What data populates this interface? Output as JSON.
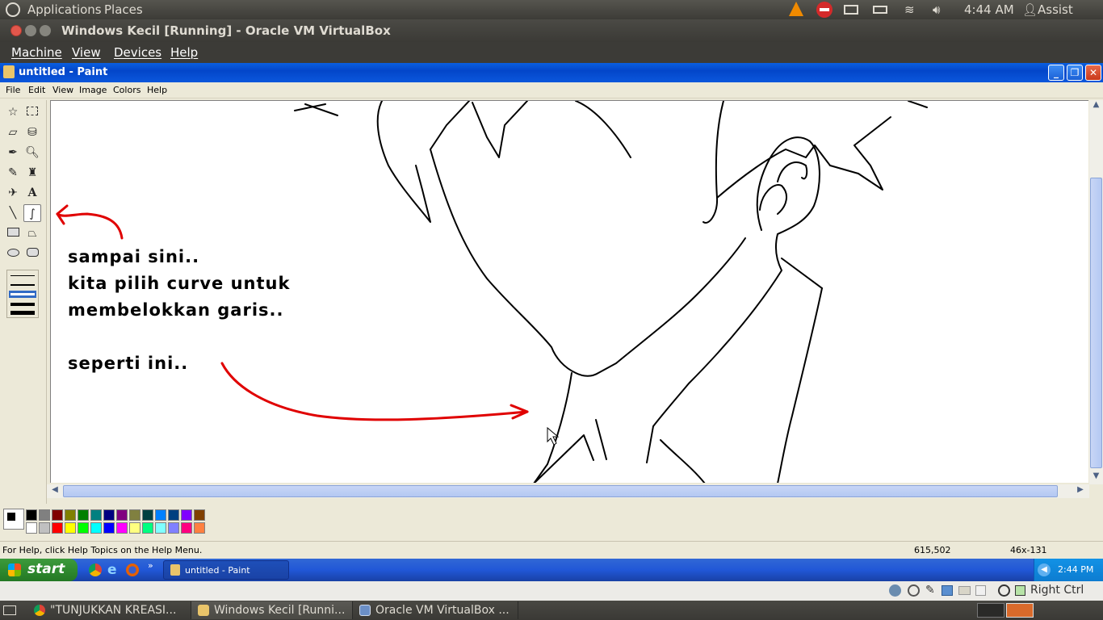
{
  "ubuntu_panel": {
    "applications": "Applications",
    "places": "Places",
    "time": "4:44 AM",
    "user": "Assist"
  },
  "vbox": {
    "title": "Windows Kecil [Running] - Oracle VM VirtualBox",
    "menu": [
      "Machine",
      "View",
      "Devices",
      "Help"
    ],
    "host_key": "Right Ctrl"
  },
  "paint": {
    "title": "untitled - Paint",
    "menu": [
      "File",
      "Edit",
      "View",
      "Image",
      "Colors",
      "Help"
    ],
    "annotations": {
      "line1": "sampai sini..",
      "line2": "kita pilih curve untuk",
      "line3": "membelokkan garis..",
      "line4": "seperti ini.."
    },
    "status_help": "For Help, click Help Topics on the Help Menu.",
    "status_coords": "615,502",
    "status_size": "46x-131",
    "palette_top": [
      "#000000",
      "#808080",
      "#800000",
      "#808000",
      "#008000",
      "#008080",
      "#000080",
      "#800080",
      "#808040",
      "#004040",
      "#0080ff",
      "#004080",
      "#8000ff",
      "#804000"
    ],
    "palette_bottom": [
      "#ffffff",
      "#c0c0c0",
      "#ff0000",
      "#ffff00",
      "#00ff00",
      "#00ffff",
      "#0000ff",
      "#ff00ff",
      "#ffff80",
      "#00ff80",
      "#80ffff",
      "#8080ff",
      "#ff0080",
      "#ff8040"
    ]
  },
  "xp_taskbar": {
    "start": "start",
    "task_paint": "untitled - Paint",
    "clock": "2:44 PM"
  },
  "ubuntu_bottom": {
    "tasks": [
      "\"TUNJUKKAN KREASI...",
      "Windows Kecil [Runni...",
      "Oracle VM VirtualBox ..."
    ]
  }
}
